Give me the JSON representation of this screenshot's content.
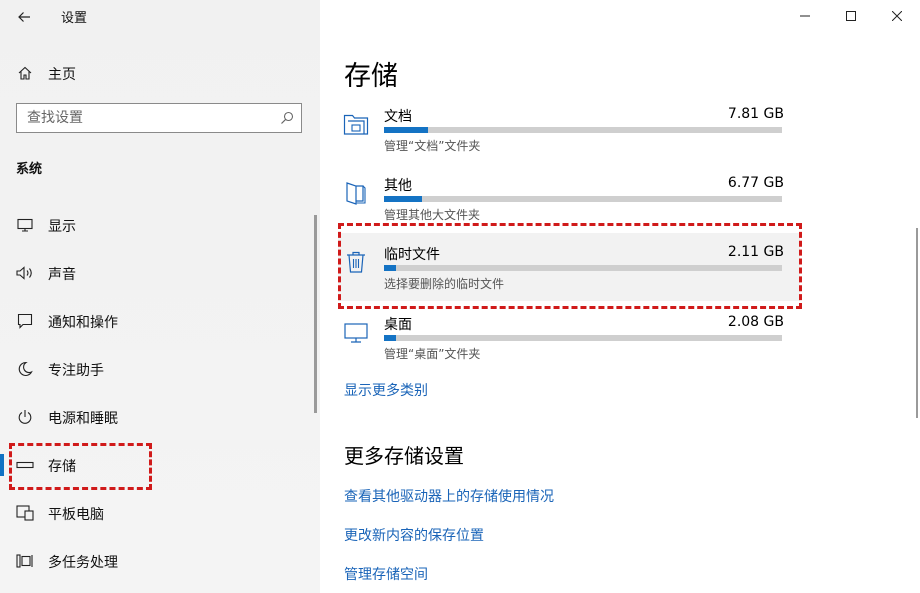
{
  "window": {
    "title": "设置",
    "controls": [
      "minimize-icon",
      "maximize-icon",
      "close-icon"
    ]
  },
  "sidebar": {
    "home_label": "主页",
    "search": {
      "placeholder": "查找设置"
    },
    "section_heading": "系统",
    "items": [
      {
        "label": "显示",
        "icon": "display-icon"
      },
      {
        "label": "声音",
        "icon": "speaker-icon"
      },
      {
        "label": "通知和操作",
        "icon": "notification-icon"
      },
      {
        "label": "专注助手",
        "icon": "moon-icon"
      },
      {
        "label": "电源和睡眠",
        "icon": "power-icon"
      },
      {
        "label": "存储",
        "icon": "storage-icon",
        "active": true
      },
      {
        "label": "平板电脑",
        "icon": "tablet-icon"
      },
      {
        "label": "多任务处理",
        "icon": "multitasking-icon"
      }
    ]
  },
  "main": {
    "title": "存储",
    "categories": [
      {
        "name": "文档",
        "size": "7.81 GB",
        "desc": "管理“文档”文件夹",
        "fill": 0.11,
        "icon": "documents-folder-icon"
      },
      {
        "name": "其他",
        "size": "6.77 GB",
        "desc": "管理其他大文件夹",
        "fill": 0.095,
        "icon": "other-files-icon"
      },
      {
        "name": "临时文件",
        "size": "2.11 GB",
        "desc": "选择要删除的临时文件",
        "fill": 0.03,
        "icon": "trash-icon"
      },
      {
        "name": "桌面",
        "size": "2.08 GB",
        "desc": "管理“桌面”文件夹",
        "fill": 0.03,
        "icon": "desktop-icon"
      }
    ],
    "show_more_link": "显示更多类别",
    "more_settings": {
      "heading": "更多存储设置",
      "links": [
        "查看其他驱动器上的存储使用情况",
        "更改新内容的保存位置",
        "管理存储空间"
      ]
    }
  },
  "colors": {
    "accent": "#1473c4",
    "link": "#1a64b8",
    "annotation": "#d01a1a"
  }
}
